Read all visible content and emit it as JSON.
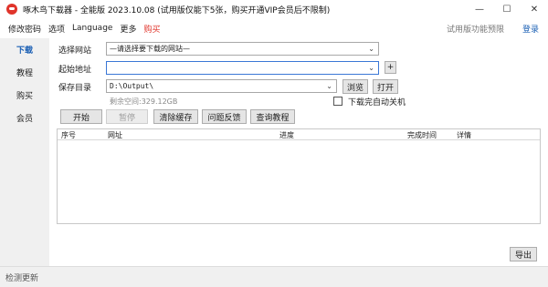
{
  "window": {
    "title": "啄木鸟下载器 - 全能版 2023.10.08 (试用版仅能下5张，购买开通VIP会员后不限制)",
    "icon": "woodpecker-app-icon",
    "controls": {
      "minimize": "—",
      "maximize": "☐",
      "close": "✕"
    }
  },
  "menu": {
    "items": [
      "修改密码",
      "选项",
      "Language",
      "更多",
      "购买"
    ],
    "trial_link": "试用版功能预限",
    "login": "登录",
    "buy_color": "#e0342b"
  },
  "sidebar": {
    "items": [
      "下载",
      "教程",
      "购买",
      "会员"
    ],
    "active": "下载"
  },
  "form": {
    "site_label": "选择网站",
    "site_value": "—请选择要下载的网站—",
    "url_label": "起始地址",
    "url_value": "",
    "add_button": "+",
    "save_label": "保存目录",
    "save_value": "D:\\Output\\",
    "browse_button": "浏览",
    "open_button": "打开",
    "auto_shutdown_label": "下载完自动关机",
    "auto_shutdown_checked": false,
    "free_space": "剩余空间:329.12GB"
  },
  "actions": {
    "start": "开始",
    "pause": "暂停",
    "clear_cache": "清除缓存",
    "feedback": "问题反馈",
    "query_tutorial": "查询教程"
  },
  "table": {
    "columns": [
      "序号",
      "网址",
      "进度",
      "完成时间",
      "详情"
    ],
    "rows": []
  },
  "export_button": "导出",
  "status": {
    "text": "检测更新"
  },
  "colors": {
    "accent": "#1a5fb4",
    "brand": "#e0342b"
  }
}
